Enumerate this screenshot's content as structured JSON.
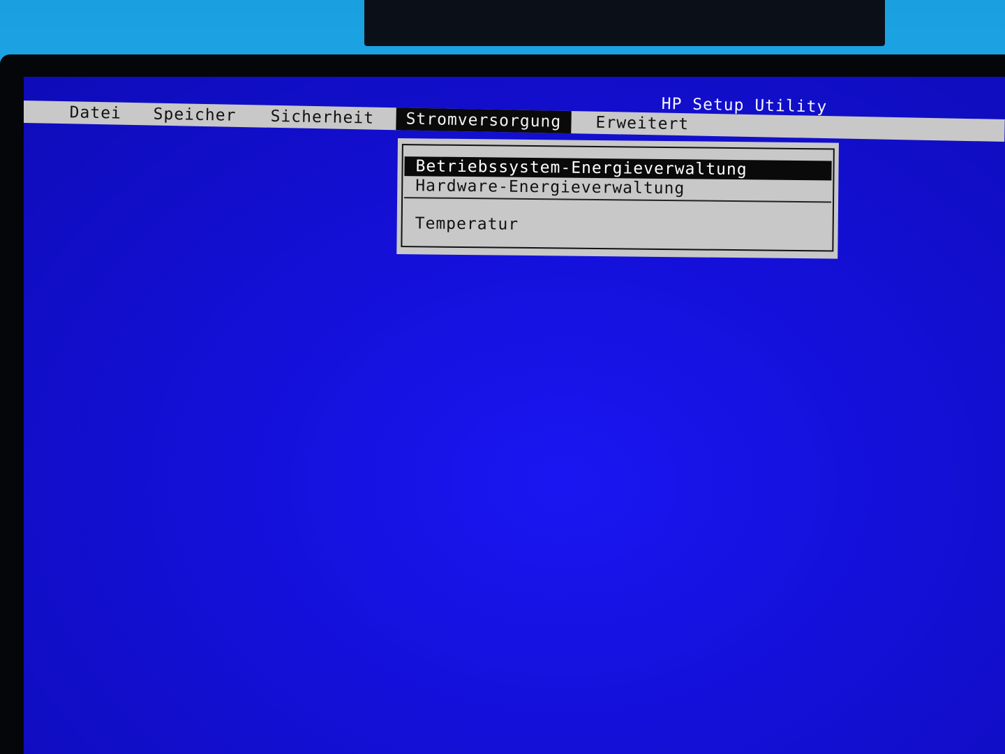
{
  "header": {
    "title": "HP Setup Utility"
  },
  "menubar": {
    "items": [
      {
        "label": "Datei"
      },
      {
        "label": "Speicher"
      },
      {
        "label": "Sicherheit"
      },
      {
        "label": "Stromversorgung"
      },
      {
        "label": "Erweitert"
      }
    ],
    "active_index": 3
  },
  "dropdown": {
    "items": [
      {
        "label": "Betriebssystem-Energieverwaltung"
      },
      {
        "label": "Hardware-Energieverwaltung"
      },
      {
        "label": "Temperatur"
      }
    ],
    "selected_index": 0
  },
  "colors": {
    "screen_background": "#1410d8",
    "menu_background": "#c8c8c8",
    "highlight": "#0a0a0a",
    "highlight_text": "#ffffff",
    "title_text": "#f4f4ff"
  }
}
